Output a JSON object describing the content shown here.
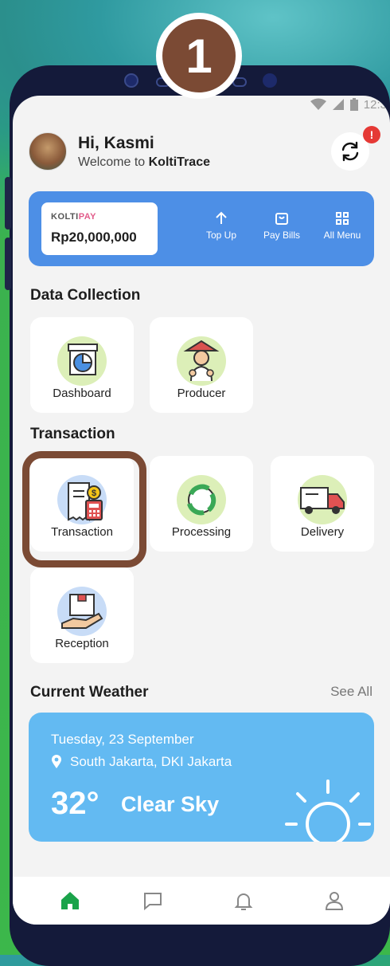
{
  "step_badge": "1",
  "status": {
    "time": "12:3"
  },
  "header": {
    "greeting": "Hi, Kasmi",
    "welcome_prefix": "Welcome to ",
    "app_name": "KoltiTrace",
    "notification_badge": "!"
  },
  "wallet": {
    "logo_brand": "KOLTI",
    "logo_suffix": "PAY",
    "balance": "Rp20,000,000",
    "actions": [
      {
        "label": "Top Up",
        "icon": "arrow-up-icon"
      },
      {
        "label": "Pay Bills",
        "icon": "bag-icon"
      },
      {
        "label": "All Menu",
        "icon": "grid-icon"
      }
    ]
  },
  "data_collection": {
    "title": "Data Collection",
    "items": [
      {
        "label": "Dashboard",
        "icon": "dashboard-chart-icon"
      },
      {
        "label": "Producer",
        "icon": "farmer-icon"
      }
    ]
  },
  "transaction": {
    "title": "Transaction",
    "items": [
      {
        "label": "Transaction",
        "icon": "receipt-calculator-icon"
      },
      {
        "label": "Processing",
        "icon": "recycle-icon"
      },
      {
        "label": "Delivery",
        "icon": "truck-icon"
      },
      {
        "label": "Reception",
        "icon": "package-hand-icon"
      }
    ]
  },
  "weather": {
    "title": "Current Weather",
    "see_all": "See All",
    "date": "Tuesday, 23 September",
    "location": "South Jakarta, DKI Jakarta",
    "temperature": "32°",
    "condition": "Clear Sky"
  },
  "tabbar": [
    {
      "icon": "home-icon",
      "active": true
    },
    {
      "icon": "chat-icon",
      "active": false
    },
    {
      "icon": "bell-icon",
      "active": false
    },
    {
      "icon": "profile-icon",
      "active": false
    }
  ],
  "colors": {
    "accent_green": "#1aa34a",
    "wallet_blue": "#4d8fe6",
    "weather_blue": "#63baf2",
    "highlight_brown": "#7b4a34",
    "notification_red": "#e53935"
  }
}
